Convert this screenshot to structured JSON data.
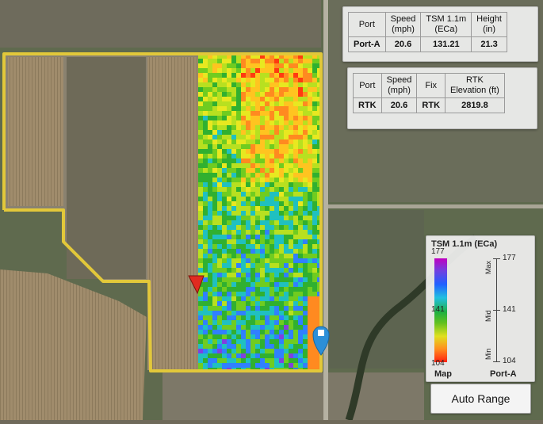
{
  "status_table_port": {
    "headers": [
      "Port",
      "Speed\n(mph)",
      "TSM 1.1m\n(ECa)",
      "Height\n(in)"
    ],
    "values": [
      "Port-A",
      "20.6",
      "131.21",
      "21.3"
    ]
  },
  "status_table_rtk": {
    "headers": [
      "Port",
      "Speed\n(mph)",
      "Fix",
      "RTK\nElevation (ft)"
    ],
    "values": [
      "RTK",
      "20.6",
      "RTK",
      "2819.8"
    ]
  },
  "legend": {
    "title": "TSM 1.1m (ECa)",
    "map_ticks": [
      "177",
      "141",
      "104"
    ],
    "port_ticks": [
      "177",
      "141",
      "104"
    ],
    "range_labels": [
      "Max",
      "Mid",
      "Min"
    ],
    "footer_left": "Map",
    "footer_right": "Port-A"
  },
  "auto_range_label": "Auto Range",
  "icons": {
    "vehicle": "red-arrow-position-icon",
    "pin": "blue-location-pin-icon"
  }
}
